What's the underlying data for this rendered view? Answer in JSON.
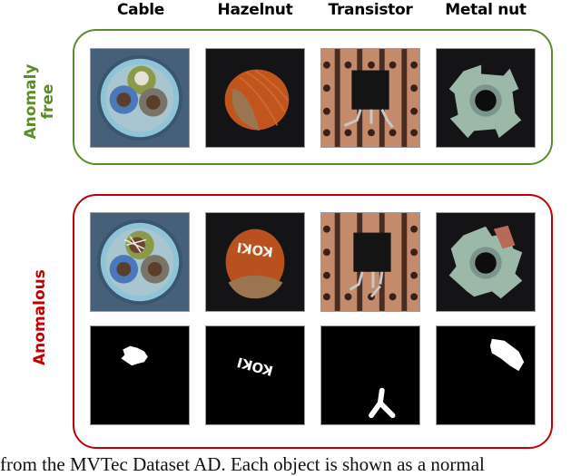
{
  "figure": {
    "columns": [
      {
        "id": "cable",
        "label": "Cable"
      },
      {
        "id": "hazelnut",
        "label": "Hazelnut"
      },
      {
        "id": "transistor",
        "label": "Transistor"
      },
      {
        "id": "metal_nut",
        "label": "Metal nut"
      }
    ],
    "groups": {
      "anomaly_free": {
        "label_line1": "Anomaly",
        "label_line2": "free",
        "color": "#5b8c2a"
      },
      "anomalous": {
        "label": "Anomalous",
        "color": "#c00000"
      }
    },
    "anomalous_text_on_hazelnut": "KOKI",
    "caption": "from the MVTec Dataset AD. Each object is shown as a normal"
  }
}
